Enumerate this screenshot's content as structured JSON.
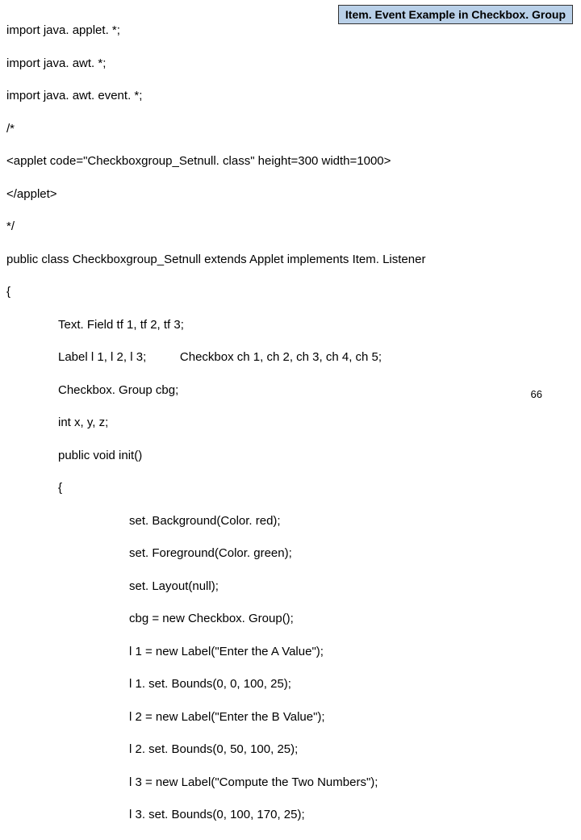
{
  "title": "Item. Event Example in Checkbox. Group",
  "page_number": "66",
  "code": {
    "l01": "import java. applet. *;",
    "l02": "import java. awt. *;",
    "l03": "import java. awt. event. *;",
    "l04": "/*",
    "l05": "<applet code=\"Checkboxgroup_Setnull. class\" height=300 width=1000>",
    "l06": "</applet>",
    "l07": "*/",
    "l08": "public class Checkboxgroup_Setnull extends Applet implements Item. Listener",
    "l09": "{",
    "l10": "Text. Field tf 1, tf 2, tf 3;",
    "l11": "Label l 1, l 2, l 3;          Checkbox ch 1, ch 2, ch 3, ch 4, ch 5;",
    "l12": "Checkbox. Group cbg;",
    "l13": "int x, y, z;",
    "l14": "public void init()",
    "l15": "{",
    "l16": "set. Background(Color. red);",
    "l17": "set. Foreground(Color. green);",
    "l18": "set. Layout(null);",
    "l19": "cbg = new Checkbox. Group();",
    "l20": "l 1 = new Label(\"Enter the A Value\");",
    "l21": "l 1. set. Bounds(0, 0, 100, 25);",
    "l22": "l 2 = new Label(\"Enter the B Value\");",
    "l23": "l 2. set. Bounds(0, 50, 100, 25);",
    "l24": "l 3 = new Label(\"Compute the Two Numbers\");",
    "l25": "l 3. set. Bounds(0, 100, 170, 25);"
  }
}
